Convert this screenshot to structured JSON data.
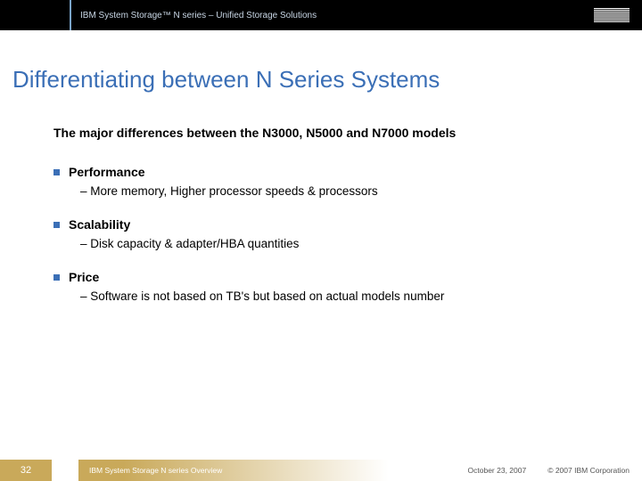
{
  "header": {
    "title": "IBM System Storage™ N series – Unified Storage Solutions",
    "logo_label": "IBM"
  },
  "main": {
    "title": "Differentiating between N Series Systems",
    "subtitle": "The major differences between the N3000, N5000 and N7000 models",
    "sections": [
      {
        "title": "Performance",
        "detail": "More memory, Higher processor speeds & processors"
      },
      {
        "title": "Scalability",
        "detail": "Disk capacity & adapter/HBA quantities"
      },
      {
        "title": "Price",
        "detail": "Software is not based on TB's but based on actual models number"
      }
    ]
  },
  "footer": {
    "page": "32",
    "doc": "IBM System Storage N series Overview",
    "date": "October 23, 2007",
    "copyright": "© 2007 IBM Corporation"
  }
}
